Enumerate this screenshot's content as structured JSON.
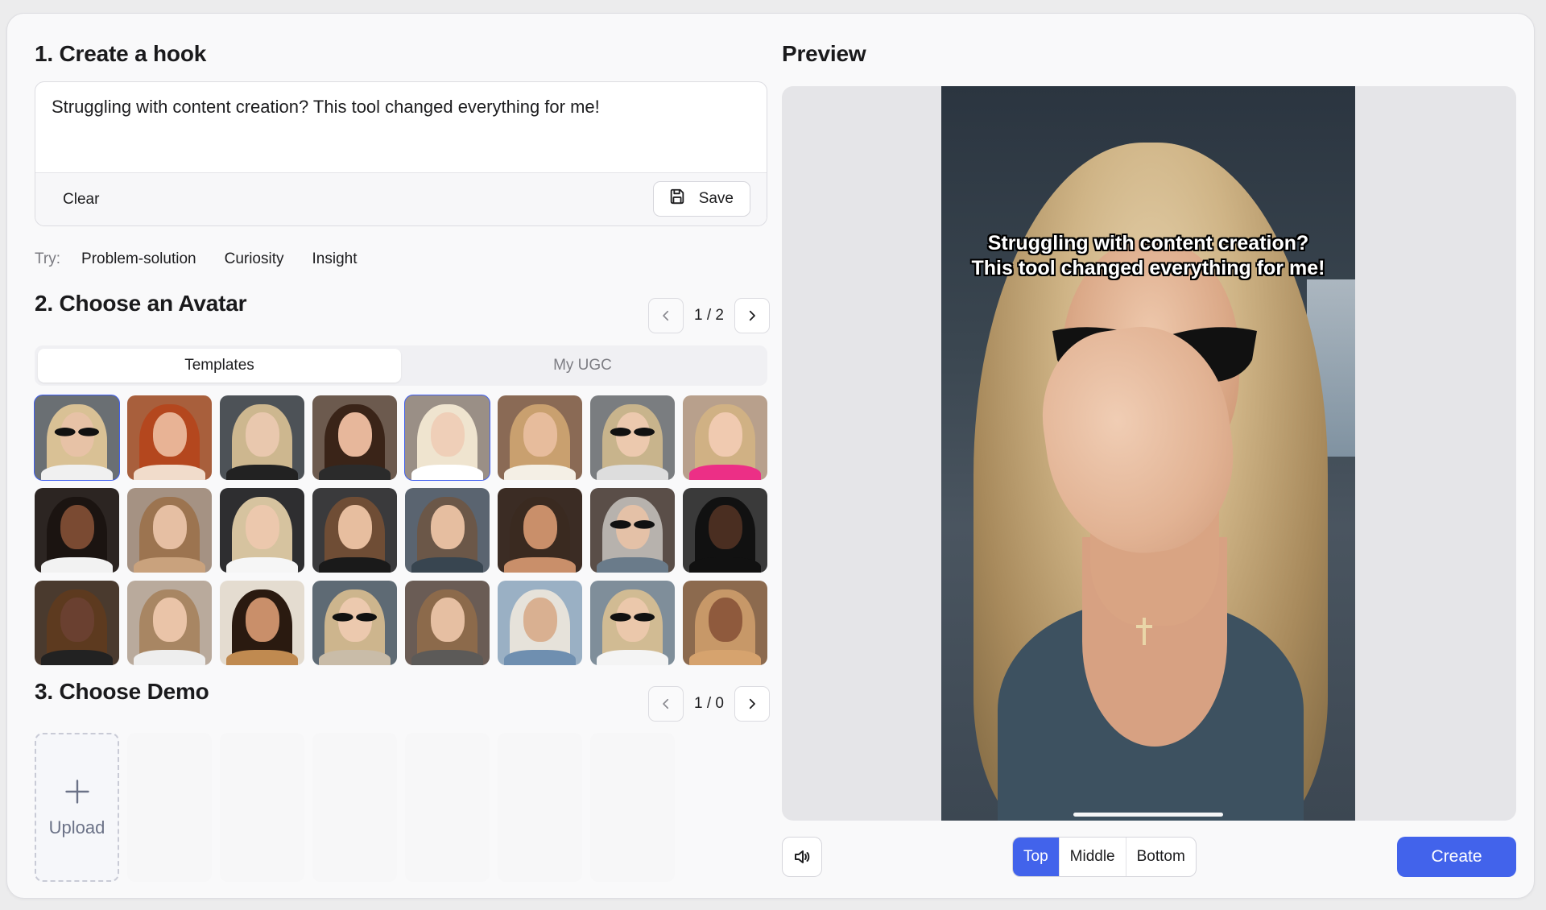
{
  "hook": {
    "title": "1. Create a hook",
    "text": "Struggling with content creation? This tool changed everything for me!",
    "clear_label": "Clear",
    "save_label": "Save",
    "try_label": "Try:",
    "suggestions": [
      "Problem-solution",
      "Curiosity",
      "Insight"
    ]
  },
  "avatar": {
    "title": "2. Choose an Avatar",
    "page": "1 / 2",
    "tabs": [
      "Templates",
      "My UGC"
    ],
    "active_tab": 0
  },
  "demo": {
    "title": "3. Choose Demo",
    "page": "1 / 0",
    "upload_label": "Upload"
  },
  "preview": {
    "title": "Preview",
    "caption": "Struggling with content creation? This tool changed everything for me!",
    "positions": [
      "Top",
      "Middle",
      "Bottom"
    ],
    "active_position": 0,
    "create_label": "Create"
  },
  "colors": {
    "accent": "#4263eb",
    "selected_outline": "#3f5ef0"
  }
}
